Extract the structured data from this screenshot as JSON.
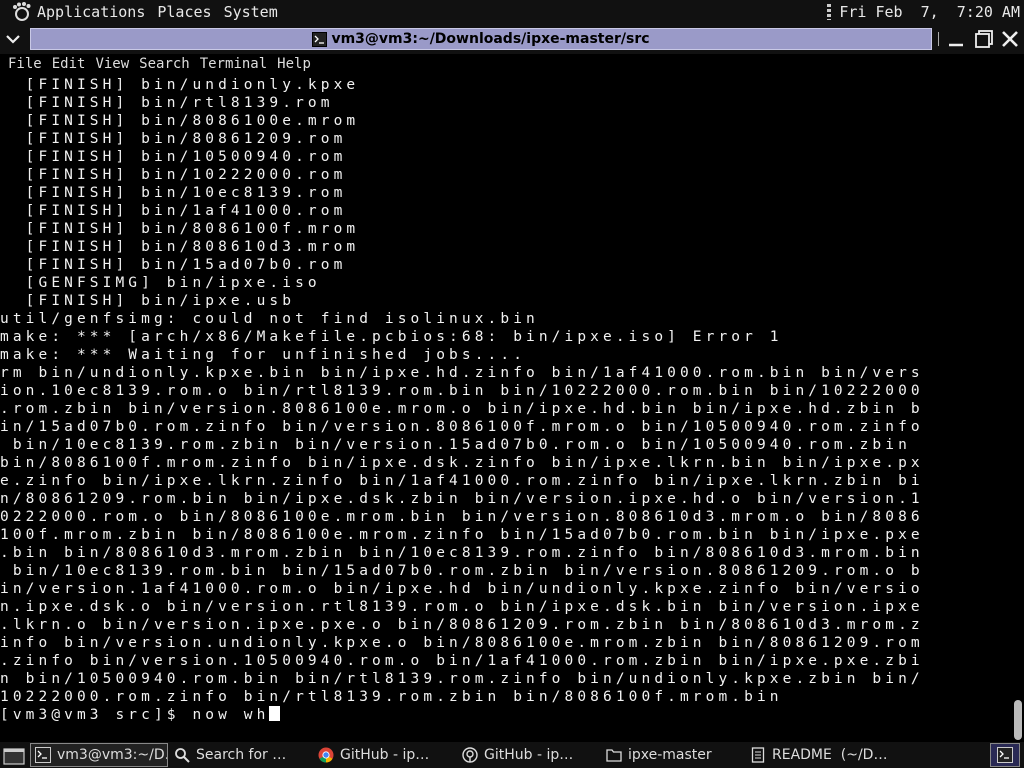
{
  "top_panel": {
    "menus": [
      "Applications",
      "Places",
      "System"
    ],
    "clock": "Fri Feb  7,  7:20 AM"
  },
  "window": {
    "title": "vm3@vm3:~/Downloads/ipxe-master/src"
  },
  "menu_bar": [
    "File",
    "Edit",
    "View",
    "Search",
    "Terminal",
    "Help"
  ],
  "terminal": {
    "lines": [
      "  [FINISH] bin/undionly.kpxe",
      "  [FINISH] bin/rtl8139.rom",
      "  [FINISH] bin/8086100e.mrom",
      "  [FINISH] bin/80861209.rom",
      "  [FINISH] bin/10500940.rom",
      "  [FINISH] bin/10222000.rom",
      "  [FINISH] bin/10ec8139.rom",
      "  [FINISH] bin/1af41000.rom",
      "  [FINISH] bin/8086100f.mrom",
      "  [FINISH] bin/808610d3.mrom",
      "  [FINISH] bin/15ad07b0.rom",
      "  [GENFSIMG] bin/ipxe.iso",
      "  [FINISH] bin/ipxe.usb",
      "util/genfsimg: could not find isolinux.bin",
      "make: *** [arch/x86/Makefile.pcbios:68: bin/ipxe.iso] Error 1",
      "make: *** Waiting for unfinished jobs....",
      "rm bin/undionly.kpxe.bin bin/ipxe.hd.zinfo bin/1af41000.rom.bin bin/vers",
      "ion.10ec8139.rom.o bin/rtl8139.rom.bin bin/10222000.rom.bin bin/10222000",
      ".rom.zbin bin/version.8086100e.mrom.o bin/ipxe.hd.bin bin/ipxe.hd.zbin b",
      "in/15ad07b0.rom.zinfo bin/version.8086100f.mrom.o bin/10500940.rom.zinfo",
      " bin/10ec8139.rom.zbin bin/version.15ad07b0.rom.o bin/10500940.rom.zbin ",
      "bin/8086100f.mrom.zinfo bin/ipxe.dsk.zinfo bin/ipxe.lkrn.bin bin/ipxe.px",
      "e.zinfo bin/ipxe.lkrn.zinfo bin/1af41000.rom.zinfo bin/ipxe.lkrn.zbin bi",
      "n/80861209.rom.bin bin/ipxe.dsk.zbin bin/version.ipxe.hd.o bin/version.1",
      "0222000.rom.o bin/8086100e.mrom.bin bin/version.808610d3.mrom.o bin/8086",
      "100f.mrom.zbin bin/8086100e.mrom.zinfo bin/15ad07b0.rom.bin bin/ipxe.pxe",
      ".bin bin/808610d3.mrom.zbin bin/10ec8139.rom.zinfo bin/808610d3.mrom.bin",
      " bin/10ec8139.rom.bin bin/15ad07b0.rom.zbin bin/version.80861209.rom.o b",
      "in/version.1af41000.rom.o bin/ipxe.hd bin/undionly.kpxe.zinfo bin/versio",
      "n.ipxe.dsk.o bin/version.rtl8139.rom.o bin/ipxe.dsk.bin bin/version.ipxe",
      ".lkrn.o bin/version.ipxe.pxe.o bin/80861209.rom.zbin bin/808610d3.mrom.z",
      "info bin/version.undionly.kpxe.o bin/8086100e.mrom.zbin bin/80861209.rom",
      ".zinfo bin/version.10500940.rom.o bin/1af41000.rom.zbin bin/ipxe.pxe.zbi",
      "n bin/10500940.rom.bin bin/rtl8139.rom.zinfo bin/undionly.kpxe.zbin bin/",
      "10222000.rom.zinfo bin/rtl8139.rom.zbin bin/8086100f.mrom.bin"
    ],
    "prompt": "[vm3@vm3 src]$ now wh"
  },
  "taskbar": {
    "items": [
      {
        "label": "vm3@vm3:~/D…",
        "icon": "terminal-icon"
      },
      {
        "label": "Search for …",
        "icon": "search-icon"
      },
      {
        "label": "GitHub - ip…",
        "icon": "chrome-icon"
      },
      {
        "label": "GitHub - ip…",
        "icon": "github-icon"
      },
      {
        "label": "ipxe-master",
        "icon": "folder-icon"
      },
      {
        "label": "README  (~/D…",
        "icon": "text-editor-icon"
      }
    ]
  }
}
